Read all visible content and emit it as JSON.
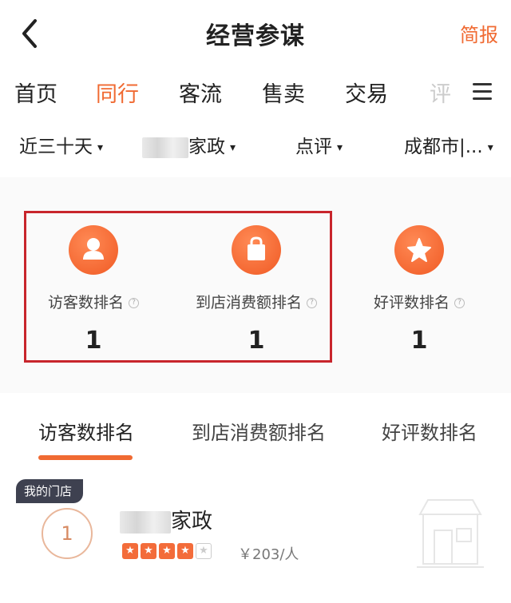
{
  "header": {
    "title": "经营参谋",
    "brief_label": "简报"
  },
  "tabs": [
    {
      "label": "首页",
      "active": false
    },
    {
      "label": "同行",
      "active": true
    },
    {
      "label": "客流",
      "active": false
    },
    {
      "label": "售卖",
      "active": false
    },
    {
      "label": "交易",
      "active": false
    },
    {
      "label": "评",
      "active": false
    }
  ],
  "filters": {
    "period": "近三十天",
    "category": "家政",
    "platform": "点评",
    "city": "成都市|..."
  },
  "stats": [
    {
      "label": "访客数排名",
      "value": "1",
      "icon": "user-icon"
    },
    {
      "label": "到店消费额排名",
      "value": "1",
      "icon": "bag-icon"
    },
    {
      "label": "好评数排名",
      "value": "1",
      "icon": "star-icon"
    }
  ],
  "help_mark": "?",
  "rank_tabs": [
    {
      "label": "访客数排名",
      "active": true
    },
    {
      "label": "到店消费额排名",
      "active": false
    },
    {
      "label": "好评数排名",
      "active": false
    }
  ],
  "ranking": {
    "badge": "我的门店",
    "rank": "1",
    "store_name": "家政",
    "rating_stars": 4,
    "rating_max": 5,
    "price": "￥203/人"
  },
  "colors": {
    "accent": "#f06a32",
    "highlight_border": "#c8252c",
    "badge_bg": "#3e4150"
  }
}
